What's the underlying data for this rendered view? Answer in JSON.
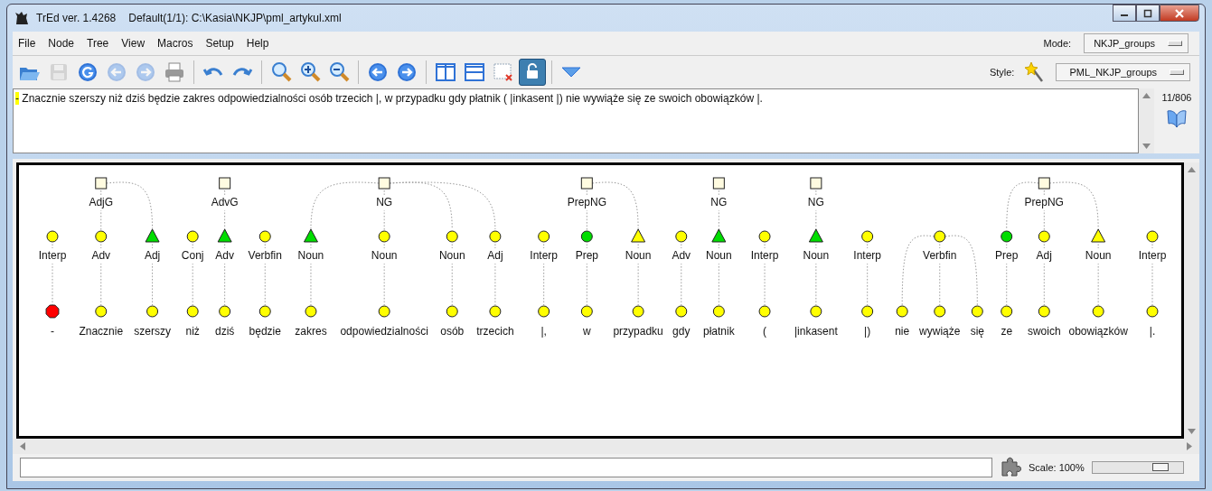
{
  "window": {
    "title": "TrEd ver. 1.4268",
    "subtitle": "Default(1/1): C:\\Kasia\\NKJP\\pml_artykul.xml"
  },
  "menu": [
    "File",
    "Node",
    "Tree",
    "View",
    "Macros",
    "Setup",
    "Help"
  ],
  "mode": {
    "label": "Mode:",
    "value": "NKJP_groups"
  },
  "toolbar": [
    {
      "kind": "open",
      "disabled": false
    },
    {
      "kind": "save",
      "disabled": true
    },
    {
      "kind": "reload",
      "disabled": false
    },
    {
      "kind": "back",
      "disabled": true
    },
    {
      "kind": "forward",
      "disabled": true
    },
    {
      "kind": "print",
      "disabled": false
    },
    {
      "kind": "separator"
    },
    {
      "kind": "undo",
      "disabled": false
    },
    {
      "kind": "redo",
      "disabled": false
    },
    {
      "kind": "separator"
    },
    {
      "kind": "zoom",
      "disabled": false
    },
    {
      "kind": "zoom-in",
      "disabled": false
    },
    {
      "kind": "zoom-out",
      "disabled": false
    },
    {
      "kind": "separator"
    },
    {
      "kind": "prev",
      "disabled": false
    },
    {
      "kind": "next",
      "disabled": false
    },
    {
      "kind": "separator"
    },
    {
      "kind": "split-v",
      "disabled": false
    },
    {
      "kind": "split-h",
      "disabled": false
    },
    {
      "kind": "close-frame",
      "disabled": false
    },
    {
      "kind": "lock",
      "disabled": false,
      "pressed": true
    },
    {
      "kind": "separator"
    },
    {
      "kind": "menu",
      "disabled": false
    }
  ],
  "style": {
    "label": "Style:",
    "value": "PML_NKJP_groups"
  },
  "sentence": {
    "marker": "-",
    "text": "Znacznie szerszy niż dziś będzie zakres odpowiedzialności osób trzecich |, w przypadku gdy płatnik ( |inkasent |) nie wywiąże się ze swoich obowiązków |."
  },
  "counter": "11/806",
  "tree": {
    "items": [
      {
        "kind": "circle",
        "label": "Interp",
        "color": "#ffff00",
        "words": [
          {
            "text": "-",
            "kind": "octagon",
            "color": "#ff0000"
          }
        ]
      },
      {
        "kind": "group",
        "label": "AdjG",
        "children": [
          {
            "label": "Adv",
            "kind": "circle",
            "color": "#ffff00",
            "head": true,
            "words": [
              {
                "text": "Znacznie",
                "kind": "circle",
                "color": "#ffff00"
              }
            ]
          },
          {
            "label": "Adj",
            "kind": "triangle",
            "color": "#00dd00",
            "head": false,
            "words": [
              {
                "text": "szerszy",
                "kind": "circle",
                "color": "#ffff00"
              }
            ]
          }
        ]
      },
      {
        "kind": "circle",
        "label": "Conj",
        "color": "#ffff00",
        "words": [
          {
            "text": "niż",
            "kind": "circle",
            "color": "#ffff00"
          }
        ]
      },
      {
        "kind": "group",
        "label": "AdvG",
        "children": [
          {
            "label": "Adv",
            "kind": "triangle",
            "color": "#00dd00",
            "words": [
              {
                "text": "dziś",
                "kind": "circle",
                "color": "#ffff00"
              }
            ]
          }
        ]
      },
      {
        "kind": "circle",
        "label": "Verbfin",
        "color": "#ffff00",
        "words": [
          {
            "text": "będzie",
            "kind": "circle",
            "color": "#ffff00"
          }
        ]
      },
      {
        "kind": "group",
        "label": "NG",
        "children": [
          {
            "label": "Noun",
            "kind": "triangle",
            "color": "#00dd00",
            "head": false,
            "words": [
              {
                "text": "zakres",
                "kind": "circle",
                "color": "#ffff00"
              }
            ]
          },
          {
            "label": "Noun",
            "kind": "circle",
            "color": "#ffff00",
            "head": true,
            "words": [
              {
                "text": "odpowiedzialności",
                "kind": "circle",
                "color": "#ffff00"
              }
            ]
          },
          {
            "label": "Noun",
            "kind": "circle",
            "color": "#ffff00",
            "head": false,
            "words": [
              {
                "text": "osób",
                "kind": "circle",
                "color": "#ffff00"
              }
            ]
          },
          {
            "label": "Adj",
            "kind": "circle",
            "color": "#ffff00",
            "head": false,
            "words": [
              {
                "text": "trzecich",
                "kind": "circle",
                "color": "#ffff00"
              }
            ]
          }
        ]
      },
      {
        "kind": "circle",
        "label": "Interp",
        "color": "#ffff00",
        "words": [
          {
            "text": "|,",
            "kind": "circle",
            "color": "#ffff00"
          }
        ]
      },
      {
        "kind": "group",
        "label": "PrepNG",
        "children": [
          {
            "label": "Prep",
            "kind": "circle",
            "color": "#00dd00",
            "head": true,
            "words": [
              {
                "text": "w",
                "kind": "circle",
                "color": "#ffff00"
              }
            ]
          },
          {
            "label": "Noun",
            "kind": "triangle",
            "color": "#ffff00",
            "head": false,
            "words": [
              {
                "text": "przypadku",
                "kind": "circle",
                "color": "#ffff00"
              }
            ]
          }
        ]
      },
      {
        "kind": "circle",
        "label": "Adv",
        "color": "#ffff00",
        "words": [
          {
            "text": "gdy",
            "kind": "circle",
            "color": "#ffff00"
          }
        ]
      },
      {
        "kind": "group",
        "label": "NG",
        "children": [
          {
            "label": "Noun",
            "kind": "triangle",
            "color": "#00dd00",
            "words": [
              {
                "text": "płatnik",
                "kind": "circle",
                "color": "#ffff00"
              }
            ]
          }
        ]
      },
      {
        "kind": "circle",
        "label": "Interp",
        "color": "#ffff00",
        "words": [
          {
            "text": "(",
            "kind": "circle",
            "color": "#ffff00"
          }
        ]
      },
      {
        "kind": "group",
        "label": "NG",
        "children": [
          {
            "label": "Noun",
            "kind": "triangle",
            "color": "#00dd00",
            "words": [
              {
                "text": "|inkasent",
                "kind": "circle",
                "color": "#ffff00"
              }
            ]
          }
        ]
      },
      {
        "kind": "circle",
        "label": "Interp",
        "color": "#ffff00",
        "words": [
          {
            "text": "|)",
            "kind": "circle",
            "color": "#ffff00"
          }
        ]
      },
      {
        "kind": "circle",
        "label": "Verbfin",
        "color": "#ffff00",
        "words": [
          {
            "text": "nie",
            "kind": "circle",
            "color": "#ffff00",
            "head": false
          },
          {
            "text": "wywiąże",
            "kind": "circle",
            "color": "#ffff00",
            "head": true
          },
          {
            "text": "się",
            "kind": "circle",
            "color": "#ffff00",
            "head": false
          }
        ]
      },
      {
        "kind": "group",
        "label": "PrepNG",
        "children": [
          {
            "label": "Prep",
            "kind": "circle",
            "color": "#00dd00",
            "head": false,
            "words": [
              {
                "text": "ze",
                "kind": "circle",
                "color": "#ffff00"
              }
            ]
          },
          {
            "label": "Adj",
            "kind": "circle",
            "color": "#ffff00",
            "head": true,
            "words": [
              {
                "text": "swoich",
                "kind": "circle",
                "color": "#ffff00"
              }
            ]
          },
          {
            "label": "Noun",
            "kind": "triangle",
            "color": "#ffff00",
            "head": false,
            "words": [
              {
                "text": "obowiązków",
                "kind": "circle",
                "color": "#ffff00"
              }
            ]
          }
        ]
      },
      {
        "kind": "circle",
        "label": "Interp",
        "color": "#ffff00",
        "words": [
          {
            "text": "|.",
            "kind": "circle",
            "color": "#ffff00"
          }
        ]
      }
    ]
  },
  "status": {
    "scale": "Scale: 100%",
    "level": 0.75
  }
}
